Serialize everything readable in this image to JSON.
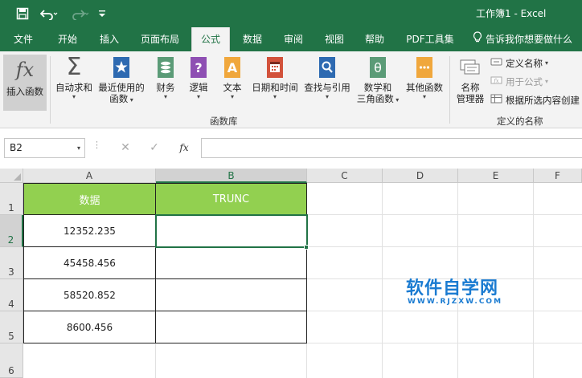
{
  "title_bar": {
    "title": "工作簿1  -  Excel",
    "quick_access": [
      "save-icon",
      "undo-icon",
      "redo-icon",
      "customize-toolbar-icon"
    ]
  },
  "tabs": [
    {
      "label": "文件"
    },
    {
      "label": "开始"
    },
    {
      "label": "插入"
    },
    {
      "label": "页面布局"
    },
    {
      "label": "公式",
      "active": true
    },
    {
      "label": "数据"
    },
    {
      "label": "审阅"
    },
    {
      "label": "视图"
    },
    {
      "label": "帮助"
    },
    {
      "label": "PDF工具集"
    }
  ],
  "tell_me": {
    "label": "告诉我你想要做什么",
    "icon": "lightbulb-icon"
  },
  "ribbon": {
    "insert_function": {
      "label": "插入函数",
      "icon": "fx-icon"
    },
    "function_library": {
      "group_label": "函数库",
      "buttons": [
        {
          "label": "自动求和",
          "icon": "sigma-icon"
        },
        {
          "label": "最近使用的",
          "label2": "函数",
          "icon": "star-book-icon"
        },
        {
          "label": "财务",
          "icon": "coins-book-icon"
        },
        {
          "label": "逻辑",
          "icon": "question-book-icon"
        },
        {
          "label": "文本",
          "icon": "text-book-icon"
        },
        {
          "label": "日期和时间",
          "icon": "calendar-book-icon"
        },
        {
          "label": "查找与引用",
          "icon": "search-book-icon"
        },
        {
          "label": "数学和",
          "label2": "三角函数",
          "icon": "theta-book-icon"
        },
        {
          "label": "其他函数",
          "icon": "more-book-icon"
        }
      ]
    },
    "defined_names": {
      "group_label": "定义的名称",
      "name_manager": {
        "label": "名称",
        "label2": "管理器",
        "icon": "name-manager-icon"
      },
      "items": [
        {
          "label": "定义名称",
          "disabled": false
        },
        {
          "label": "用于公式",
          "disabled": true
        },
        {
          "label": "根据所选内容创建",
          "disabled": false
        }
      ]
    }
  },
  "formula_bar": {
    "name_box": "B2",
    "formula": "",
    "fx_label": "fx"
  },
  "sheet": {
    "columns": [
      "A",
      "B",
      "C",
      "D",
      "E",
      "F"
    ],
    "selected_column": "B",
    "rows": [
      "1",
      "2",
      "3",
      "4",
      "5",
      "6"
    ],
    "selected_row": "2",
    "selected_cell": "B2",
    "header": {
      "col_a": "数据",
      "col_b": "TRUNC"
    },
    "data": [
      {
        "a": "12352.235",
        "b": ""
      },
      {
        "a": "45458.456",
        "b": ""
      },
      {
        "a": "58520.852",
        "b": ""
      },
      {
        "a": "8600.456",
        "b": ""
      }
    ],
    "header_fill": "#92d050",
    "accent": "#217346"
  },
  "watermark": {
    "main": "软件自学网",
    "sub": "WWW.RJZXW.COM"
  }
}
